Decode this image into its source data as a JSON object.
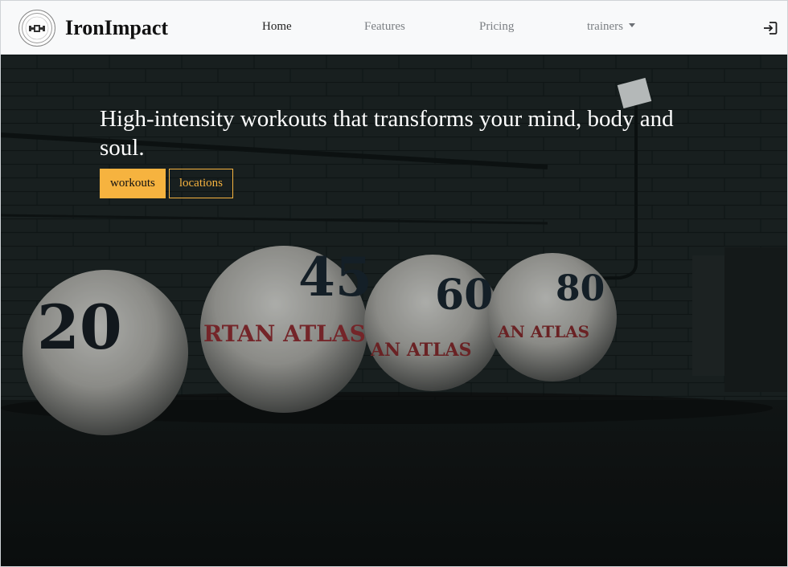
{
  "brand": {
    "name": "IronImpact",
    "logo_icon": "dumbbell-emblem-icon"
  },
  "nav": {
    "links": [
      {
        "label": "Home",
        "active": true
      },
      {
        "label": "Features",
        "active": false
      },
      {
        "label": "Pricing",
        "active": false
      }
    ],
    "dropdown": {
      "label": "trainers",
      "icon": "caret-down-icon"
    },
    "login_icon": "sign-in-icon"
  },
  "hero": {
    "title": "High-intensity workouts that transforms your mind, body and soul.",
    "primary_button": "workouts",
    "secondary_button": "locations",
    "background_image": "atlas-stone-balls-photo",
    "balls": [
      {
        "number": "20",
        "text": ""
      },
      {
        "number": "45",
        "text": "RTAN ATLAS"
      },
      {
        "number": "60",
        "text": "AN ATLAS"
      },
      {
        "number": "80",
        "text": "AN ATLAS"
      }
    ]
  },
  "colors": {
    "accent": "#f6b33f",
    "navbar_bg": "#f8f9fa",
    "hero_text": "#ffffff"
  }
}
